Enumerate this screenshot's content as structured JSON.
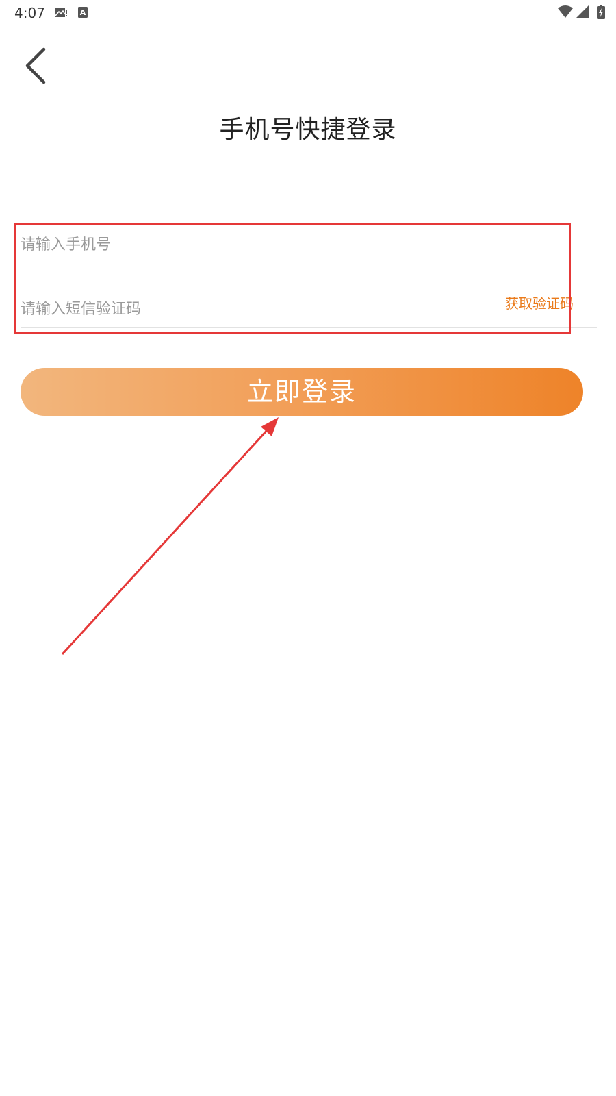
{
  "status_bar": {
    "time": "4:07",
    "icons": [
      "image-icon",
      "keyboard-a-icon",
      "wifi-icon",
      "signal-icon",
      "battery-icon"
    ]
  },
  "header": {
    "back_icon": "chevron-left-icon",
    "title": "手机号快捷登录"
  },
  "form": {
    "phone": {
      "placeholder": "请输入手机号",
      "value": ""
    },
    "sms_code": {
      "placeholder": "请输入短信验证码",
      "value": "",
      "get_code_label": "获取验证码"
    }
  },
  "login_button": {
    "label": "立即登录"
  },
  "colors": {
    "accent": "#ea7a1a",
    "button_gradient_start": "#f2b67d",
    "button_gradient_end": "#ee8329",
    "annotation_red": "#e53838"
  }
}
